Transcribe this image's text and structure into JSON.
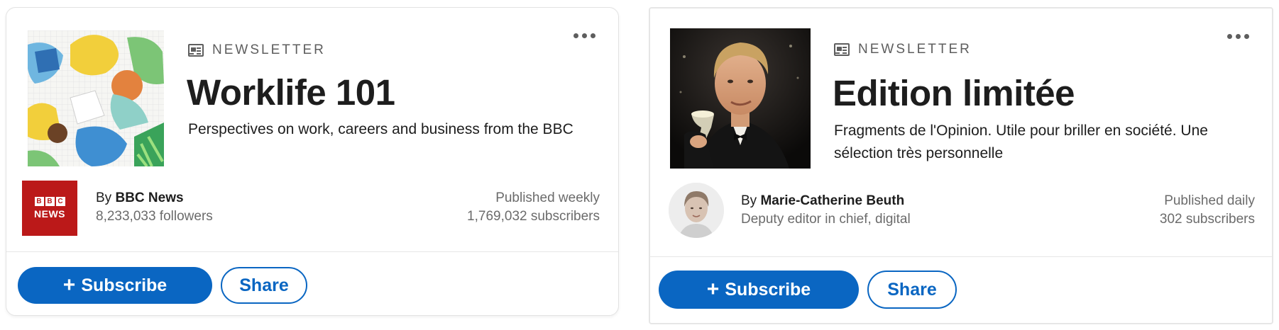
{
  "colors": {
    "accent": "#0a66c2",
    "bbc_red": "#bb1919",
    "secondary_text": "#6b6b6b"
  },
  "cards": [
    {
      "kicker": "NEWSLETTER",
      "kicker_icon": "newsletter-icon",
      "title": "Worklife 101",
      "description": "Perspectives on work, careers and business from the BBC",
      "author_prefix": "By",
      "author_name": "BBC News",
      "author_sub": "8,233,033 followers",
      "logo_letters": [
        "B",
        "B",
        "C"
      ],
      "logo_word": "NEWS",
      "frequency": "Published weekly",
      "subscribers": "1,769,032 subscribers",
      "subscribe_label": "Subscribe",
      "share_label": "Share",
      "more_icon": "more-options-icon"
    },
    {
      "kicker": "NEWSLETTER",
      "kicker_icon": "newsletter-icon",
      "title": "Edition limitée",
      "description": "Fragments de l'Opinion. Utile pour briller en société. Une sélection très personnelle",
      "author_prefix": "By",
      "author_name": "Marie-Catherine Beuth",
      "author_sub": "Deputy editor in chief, digital",
      "frequency": "Published daily",
      "subscribers": "302 subscribers",
      "subscribe_label": "Subscribe",
      "share_label": "Share",
      "more_icon": "more-options-icon"
    }
  ]
}
